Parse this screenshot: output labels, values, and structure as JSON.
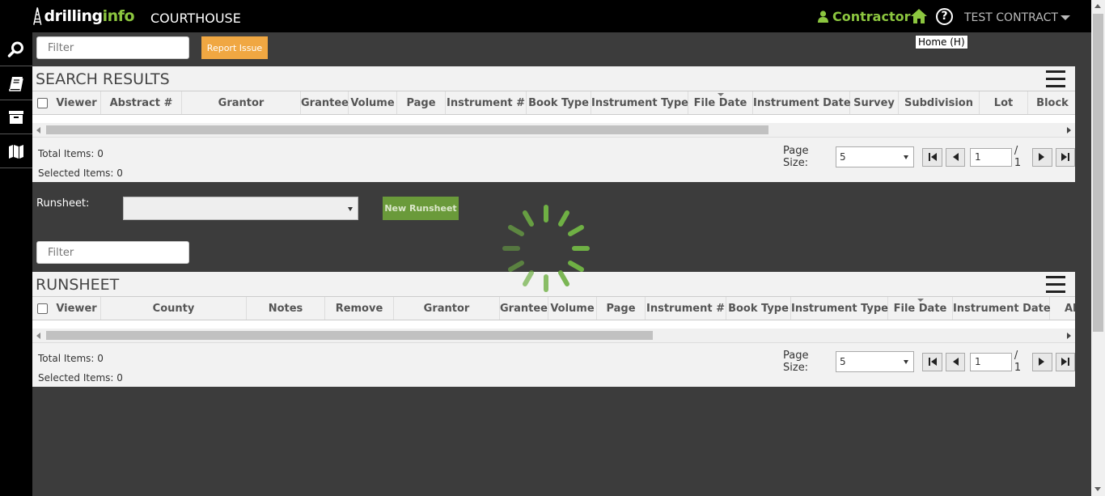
{
  "header": {
    "logo_text_a": "drilling",
    "logo_text_b": "info",
    "app_name": "COURTHOUSE",
    "contractor_label": "Contractor",
    "user_name": "TEST CONTRACT",
    "tooltip": "Home (H)"
  },
  "toolbar": {
    "filter_placeholder": "Filter",
    "report_issue_label": "Report Issue"
  },
  "search_results": {
    "title": "SEARCH RESULTS",
    "columns": [
      "Viewer",
      "Abstract #",
      "Grantor",
      "Grantee",
      "Volume",
      "Page",
      "Instrument #",
      "Book Type",
      "Instrument Type",
      "File Date",
      "Instrument Date",
      "Survey",
      "Subdivision",
      "Lot",
      "Block"
    ],
    "total_items": "Total Items: 0",
    "selected_items": "Selected Items: 0",
    "page_size_label": "Page Size:",
    "page_size_value": "5",
    "page_current": "1",
    "page_total": "/ 1"
  },
  "runsheet_controls": {
    "label": "Runsheet:",
    "new_button": "New Runsheet",
    "filter_placeholder": "Filter"
  },
  "runsheet": {
    "title": "RUNSHEET",
    "columns": [
      "Viewer",
      "County",
      "Notes",
      "Remove",
      "Grantor",
      "Grantee",
      "Volume",
      "Page",
      "Instrument #",
      "Book Type",
      "Instrument Type",
      "File Date",
      "Instrument Date",
      "Al"
    ],
    "total_items": "Total Items: 0",
    "selected_items": "Selected Items: 0",
    "page_size_label": "Page Size:",
    "page_size_value": "5",
    "page_current": "1",
    "page_total": "/ 1"
  },
  "colors": {
    "brand_green": "#8cc63f",
    "report_orange": "#f0a742",
    "new_runsheet_green": "#6a9a3a"
  },
  "icons": {
    "sidebar": [
      "search-icon",
      "book-icon",
      "archive-box-icon",
      "map-icon"
    ],
    "topbar": [
      "user-icon",
      "home-icon",
      "help-icon",
      "chevron-down-icon"
    ]
  }
}
